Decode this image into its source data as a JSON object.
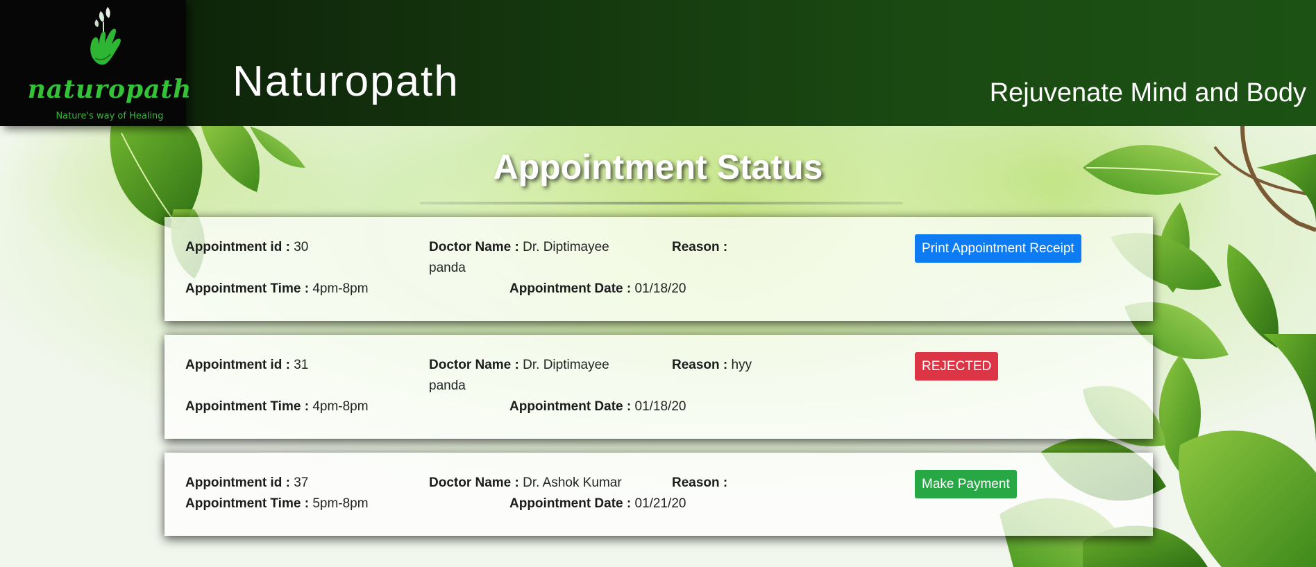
{
  "header": {
    "logo_word": "naturopath",
    "logo_tagline": "Nature's way of Healing",
    "brand_title": "Naturopath",
    "tagline": "Rejuvenate Mind and Body"
  },
  "page_title": "Appointment Status",
  "labels": {
    "appointment_id": "Appointment id :",
    "doctor_name": "Doctor Name :",
    "reason": "Reason :",
    "appointment_time": "Appointment Time :",
    "appointment_date": "Appointment Date :"
  },
  "appointments": [
    {
      "id": "30",
      "doctor": "Dr. Diptimayee panda",
      "reason": "",
      "time": "4pm-8pm",
      "date": "01/18/20",
      "action_label": "Print Appointment Receipt",
      "action_color": "#0d7cf2"
    },
    {
      "id": "31",
      "doctor": "Dr. Diptimayee panda",
      "reason": "hyy",
      "time": "4pm-8pm",
      "date": "01/18/20",
      "action_label": "REJECTED",
      "action_color": "#dc3545"
    },
    {
      "id": "37",
      "doctor": "Dr. Ashok Kumar",
      "reason": "",
      "time": "5pm-8pm",
      "date": "01/21/20",
      "action_label": "Make Payment",
      "action_color": "#28a745"
    }
  ],
  "colors": {
    "header_green": "#1a4a12",
    "logo_green": "#34c238",
    "print_blue": "#0d7cf2",
    "rejected_red": "#dc3545",
    "payment_green": "#28a745"
  }
}
